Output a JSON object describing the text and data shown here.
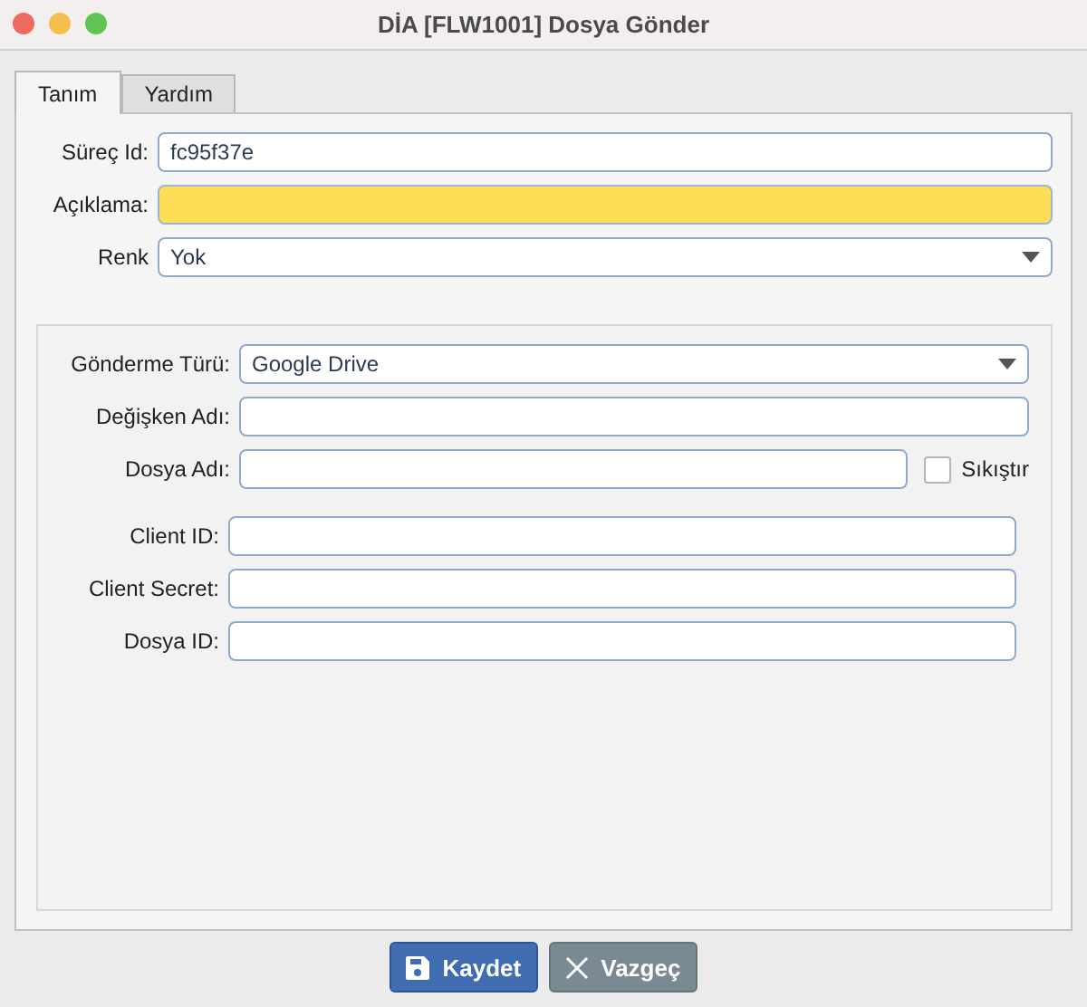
{
  "window": {
    "title": "DİA [FLW1001] Dosya Gönder"
  },
  "tabs": [
    {
      "label": "Tanım",
      "selected": true
    },
    {
      "label": "Yardım",
      "selected": false
    }
  ],
  "top_fields": [
    {
      "kind": "text",
      "label": "Süreç Id:",
      "value": "fc95f37e"
    },
    {
      "kind": "highlight",
      "label": "Açıklama:"
    },
    {
      "kind": "select",
      "label": "Renk",
      "value": "Yok"
    }
  ],
  "group_fields": [
    {
      "kind": "select",
      "label": "Gönderme Türü:",
      "value": "Google Drive"
    },
    {
      "kind": "text",
      "label": "Değişken Adı:"
    },
    {
      "kind": "text_check",
      "label": "Dosya Adı:",
      "check_label": "Sıkıştır",
      "checked": false
    }
  ],
  "client_fields": [
    {
      "label": "Client ID:"
    },
    {
      "label": "Client Secret:"
    },
    {
      "label": "Dosya ID:"
    }
  ],
  "buttons": [
    {
      "kind": "save",
      "label": "Kaydet"
    },
    {
      "kind": "cancel",
      "label": "Vazgeç"
    }
  ]
}
